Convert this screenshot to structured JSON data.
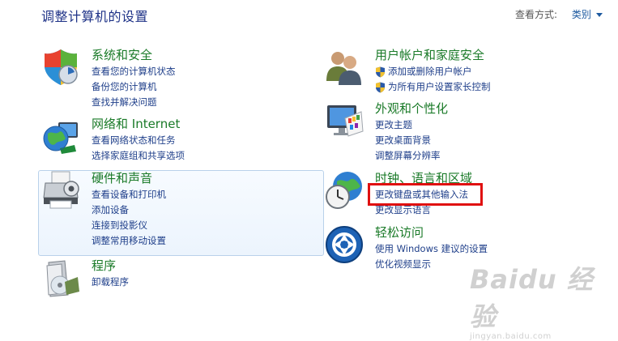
{
  "header": {
    "title": "调整计算机的设置",
    "view_by_label": "查看方式:",
    "view_by_value": "类别"
  },
  "categories": {
    "system": {
      "title": "系统和安全",
      "links": [
        "查看您的计算机状态",
        "备份您的计算机",
        "查找并解决问题"
      ]
    },
    "network": {
      "title": "网络和 Internet",
      "links": [
        "查看网络状态和任务",
        "选择家庭组和共享选项"
      ]
    },
    "hardware": {
      "title": "硬件和声音",
      "links": [
        "查看设备和打印机",
        "添加设备",
        "连接到投影仪",
        "调整常用移动设置"
      ]
    },
    "programs": {
      "title": "程序",
      "links": [
        "卸载程序"
      ]
    },
    "users": {
      "title": "用户帐户和家庭安全",
      "links": [
        "添加或删除用户帐户",
        "为所有用户设置家长控制"
      ]
    },
    "appearance": {
      "title": "外观和个性化",
      "links": [
        "更改主题",
        "更改桌面背景",
        "调整屏幕分辨率"
      ]
    },
    "clock": {
      "title": "时钟、语言和区域",
      "links": [
        "更改键盘或其他输入法",
        "更改显示语言"
      ]
    },
    "ease": {
      "title": "轻松访问",
      "links": [
        "使用 Windows 建议的设置",
        "优化视频显示"
      ]
    }
  },
  "watermark": {
    "brand": "Baidu 经验",
    "url": "jingyan.baidu.com"
  }
}
